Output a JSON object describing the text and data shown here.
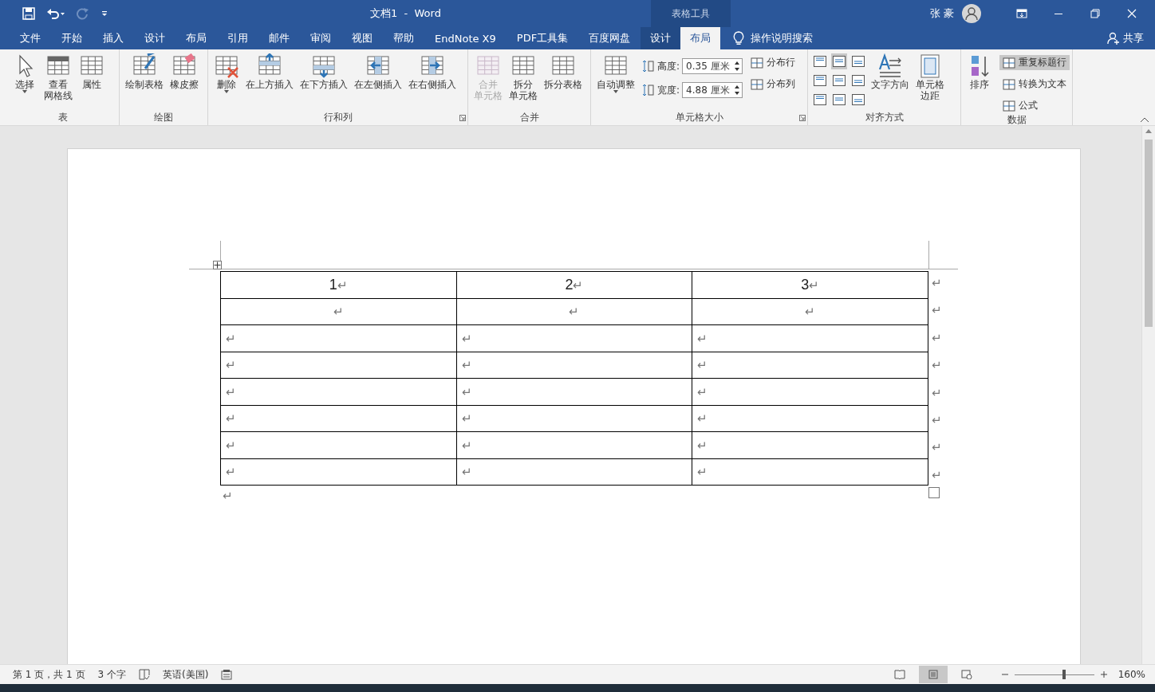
{
  "window": {
    "title": "文档1  -  Word",
    "context_label": "表格工具",
    "user": "张 豪"
  },
  "tabs": [
    {
      "label": "文件",
      "kind": "normal",
      "selected": false
    },
    {
      "label": "开始",
      "kind": "normal",
      "selected": false
    },
    {
      "label": "插入",
      "kind": "normal",
      "selected": false
    },
    {
      "label": "设计",
      "kind": "normal",
      "selected": false
    },
    {
      "label": "布局",
      "kind": "normal",
      "selected": false
    },
    {
      "label": "引用",
      "kind": "normal",
      "selected": false
    },
    {
      "label": "邮件",
      "kind": "normal",
      "selected": false
    },
    {
      "label": "审阅",
      "kind": "normal",
      "selected": false
    },
    {
      "label": "视图",
      "kind": "normal",
      "selected": false
    },
    {
      "label": "帮助",
      "kind": "normal",
      "selected": false
    },
    {
      "label": "EndNote X9",
      "kind": "normal",
      "selected": false
    },
    {
      "label": "PDF工具集",
      "kind": "normal",
      "selected": false
    },
    {
      "label": "百度网盘",
      "kind": "normal",
      "selected": false
    },
    {
      "label": "设计",
      "kind": "contextual",
      "selected": false
    },
    {
      "label": "布局",
      "kind": "contextual",
      "selected": true
    }
  ],
  "tell_me": "操作说明搜索",
  "share": "共享",
  "ribbon": [
    {
      "label": "表",
      "launcher": false,
      "columns": [
        [
          {
            "kind": "large",
            "label": "选择",
            "dropdown": true,
            "disabled": false
          }
        ],
        [
          {
            "kind": "large",
            "lines": [
              "查看",
              "网格线"
            ],
            "dropdown": false,
            "disabled": false
          }
        ],
        [
          {
            "kind": "large",
            "label": "属性",
            "dropdown": false,
            "disabled": false
          }
        ]
      ]
    },
    {
      "label": "绘图",
      "launcher": false,
      "columns": [
        [
          {
            "kind": "large",
            "label": "绘制表格",
            "dropdown": false,
            "disabled": false
          }
        ],
        [
          {
            "kind": "large",
            "label": "橡皮擦",
            "dropdown": false,
            "disabled": false
          }
        ]
      ]
    },
    {
      "label": "行和列",
      "launcher": true,
      "columns": [
        [
          {
            "kind": "large",
            "label": "删除",
            "dropdown": true,
            "disabled": false
          }
        ],
        [
          {
            "kind": "large",
            "label": "在上方插入",
            "dropdown": false,
            "disabled": false
          }
        ],
        [
          {
            "kind": "large",
            "label": "在下方插入",
            "dropdown": false,
            "disabled": false
          }
        ],
        [
          {
            "kind": "large",
            "label": "在左侧插入",
            "dropdown": false,
            "disabled": false
          }
        ],
        [
          {
            "kind": "large",
            "label": "在右侧插入",
            "dropdown": false,
            "disabled": false
          }
        ]
      ]
    },
    {
      "label": "合并",
      "launcher": false,
      "columns": [
        [
          {
            "kind": "large",
            "lines": [
              "合并",
              "单元格"
            ],
            "dropdown": false,
            "disabled": true
          }
        ],
        [
          {
            "kind": "large",
            "lines": [
              "拆分",
              "单元格"
            ],
            "dropdown": false,
            "disabled": false
          }
        ],
        [
          {
            "kind": "large",
            "label": "拆分表格",
            "dropdown": false,
            "disabled": false
          }
        ]
      ]
    },
    {
      "label": "单元格大小",
      "launcher": true,
      "columns": [
        [
          {
            "kind": "large",
            "label": "自动调整",
            "dropdown": true,
            "disabled": false
          }
        ],
        [
          {
            "kind": "field",
            "label": "高度:",
            "value": "0.35 厘米"
          },
          {
            "kind": "field",
            "label": "宽度:",
            "value": "4.88 厘米"
          }
        ],
        [
          {
            "kind": "small",
            "label": "分布行",
            "selected": false
          },
          {
            "kind": "small",
            "label": "分布列",
            "selected": false
          }
        ]
      ]
    },
    {
      "label": "对齐方式",
      "launcher": false,
      "columns": [
        [
          {
            "kind": "align",
            "selected": false
          },
          {
            "kind": "align",
            "selected": false
          },
          {
            "kind": "align",
            "selected": false
          }
        ],
        [
          {
            "kind": "align",
            "selected": true
          },
          {
            "kind": "align",
            "selected": false
          },
          {
            "kind": "align",
            "selected": false
          }
        ],
        [
          {
            "kind": "align",
            "selected": false
          },
          {
            "kind": "align",
            "selected": false
          },
          {
            "kind": "align",
            "selected": false
          }
        ],
        [
          {
            "kind": "large",
            "label": "文字方向",
            "dropdown": false,
            "disabled": false
          }
        ],
        [
          {
            "kind": "large",
            "lines": [
              "单元格",
              "边距"
            ],
            "dropdown": false,
            "disabled": false
          }
        ]
      ]
    },
    {
      "label": "数据",
      "launcher": false,
      "columns": [
        [
          {
            "kind": "large",
            "label": "排序",
            "dropdown": false,
            "disabled": false
          }
        ],
        [
          {
            "kind": "small",
            "label": "重复标题行",
            "selected": true
          },
          {
            "kind": "small",
            "label": "转换为文本",
            "selected": false
          },
          {
            "kind": "small",
            "label": "公式",
            "selected": false
          }
        ]
      ]
    }
  ],
  "document": {
    "table": {
      "rows": [
        {
          "centered": true,
          "end_mark": "↵",
          "cells": [
            {
              "text": "1",
              "mark": "↵"
            },
            {
              "text": "2",
              "mark": "↵"
            },
            {
              "text": "3",
              "mark": "↵"
            }
          ]
        },
        {
          "centered": true,
          "end_mark": "↵",
          "cells": [
            {
              "mark": "↵"
            },
            {
              "mark": "↵"
            },
            {
              "mark": "↵"
            }
          ]
        },
        {
          "centered": false,
          "end_mark": "↵",
          "cells": [
            {
              "mark": "↵"
            },
            {
              "mark": "↵"
            },
            {
              "mark": "↵"
            }
          ]
        },
        {
          "centered": false,
          "end_mark": "↵",
          "cells": [
            {
              "mark": "↵"
            },
            {
              "mark": "↵"
            },
            {
              "mark": "↵"
            }
          ]
        },
        {
          "centered": false,
          "end_mark": "↵",
          "cells": [
            {
              "mark": "↵"
            },
            {
              "mark": "↵"
            },
            {
              "mark": "↵"
            }
          ]
        },
        {
          "centered": false,
          "end_mark": "↵",
          "cells": [
            {
              "mark": "↵"
            },
            {
              "mark": "↵"
            },
            {
              "mark": "↵"
            }
          ]
        },
        {
          "centered": false,
          "end_mark": "↵",
          "cells": [
            {
              "mark": "↵"
            },
            {
              "mark": "↵"
            },
            {
              "mark": "↵"
            }
          ]
        },
        {
          "centered": false,
          "end_mark": "↵",
          "cells": [
            {
              "mark": "↵"
            },
            {
              "mark": "↵"
            },
            {
              "mark": "↵"
            }
          ]
        }
      ]
    },
    "after_mark": "↵"
  },
  "status_bar": {
    "page": "第 1 页，共 1 页",
    "words": "3 个字",
    "language": "英语(美国)",
    "views": [
      {
        "selected": false
      },
      {
        "selected": true
      },
      {
        "selected": false
      }
    ],
    "zoom": {
      "level": 0.62,
      "reading": "160%"
    }
  }
}
